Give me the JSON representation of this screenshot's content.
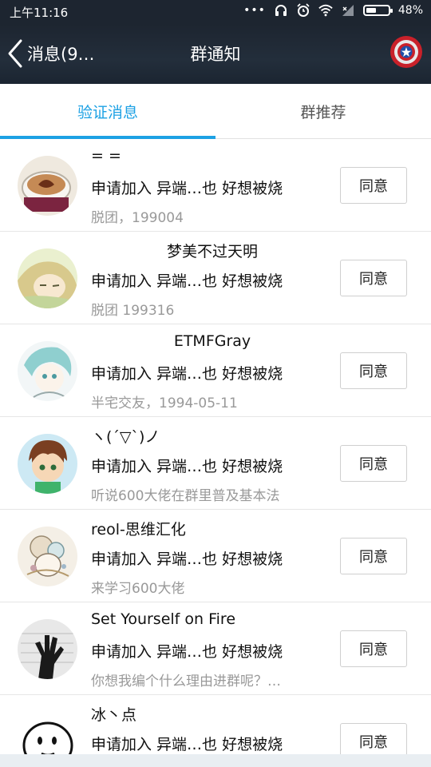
{
  "statusbar": {
    "time": "上午11:16",
    "battery": "48%",
    "battery_level": 0.48
  },
  "nav": {
    "back_label": "消息(9…",
    "title": "群通知",
    "avatar_icon": "captain-shield-icon"
  },
  "tabs": [
    {
      "label": "验证消息",
      "active": true
    },
    {
      "label": "群推荐",
      "active": false
    }
  ],
  "items": [
    {
      "nick": "= =",
      "request": "申请加入 异端…也 好想被烧",
      "sub": "脱团，199004",
      "button": "同意",
      "avatar_colors": [
        "#f0ebe2",
        "#8b4a2a"
      ]
    },
    {
      "nick": "梦美不过天明",
      "request": "申请加入 异端…也 好想被烧",
      "sub": "脱团 199316",
      "button": "同意",
      "avatar_colors": [
        "#e6eec7",
        "#c9b87c"
      ]
    },
    {
      "nick": "ETMFGray",
      "request": "申请加入 异端…也 好想被烧",
      "sub": "半宅交友，1994-05-11",
      "button": "同意",
      "avatar_colors": [
        "#eef4f5",
        "#7fc7c9"
      ]
    },
    {
      "nick": "ヽ(´▽`)ノ",
      "request": "申请加入 异端…也 好想被烧",
      "sub": "听说600大佬在群里普及基本法",
      "button": "同意",
      "avatar_colors": [
        "#d8eef7",
        "#7a3f21"
      ]
    },
    {
      "nick": "reol-思维汇化",
      "request": "申请加入 异端…也 好想被烧",
      "sub": "来学习600大佬",
      "button": "同意",
      "avatar_colors": [
        "#f3eee5",
        "#8a7a66"
      ]
    },
    {
      "nick": "Set Yourself on Fire",
      "request": "申请加入 异端…也 好想被烧",
      "sub": "你想我编个什么理由进群呢？…",
      "button": "同意",
      "avatar_colors": [
        "#e5e5e5",
        "#222222"
      ]
    },
    {
      "nick": "冰丶点",
      "request": "申请加入 异端…也 好想被烧",
      "sub": "",
      "button": "同意",
      "avatar_colors": [
        "#ffffff",
        "#000000"
      ]
    }
  ],
  "colors": {
    "accent": "#1da1e4",
    "header_bg": "#1d2530"
  }
}
